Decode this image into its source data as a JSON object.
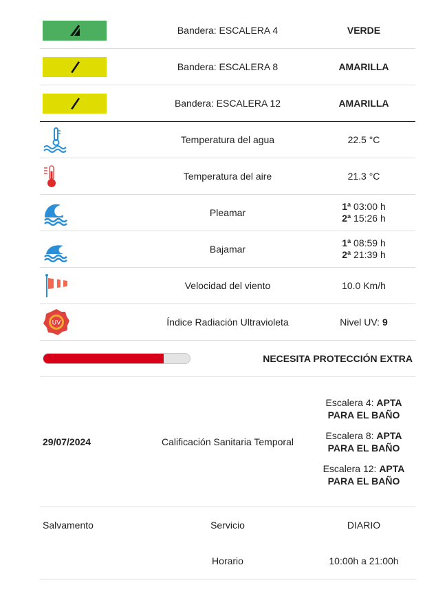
{
  "flags": [
    {
      "label": "Bandera: ESCALERA 4",
      "status": "VERDE",
      "color": "#4caf5f"
    },
    {
      "label": "Bandera: ESCALERA 8",
      "status": "AMARILLA",
      "color": "#dedc00"
    },
    {
      "label": "Bandera: ESCALERA 12",
      "status": "AMARILLA",
      "color": "#dedc00"
    }
  ],
  "water_temp": {
    "label": "Temperatura del agua",
    "value": "22.5 °C",
    "icon": "water-thermometer-icon"
  },
  "air_temp": {
    "label": "Temperatura del aire",
    "value": "21.3 °C",
    "icon": "thermometer-icon"
  },
  "high_tide": {
    "label": "Pleamar",
    "icon": "wave-icon",
    "first_ord": "1ª",
    "first_time": " 03:00 h",
    "second_ord": "2ª",
    "second_time": " 15:26 h"
  },
  "low_tide": {
    "label": "Bajamar",
    "icon": "low-wave-icon",
    "first_ord": "1ª",
    "first_time": " 08:59 h",
    "second_ord": "2ª",
    "second_time": " 21:39 h"
  },
  "wind": {
    "label": "Velocidad del viento",
    "value": "10.0 Km/h",
    "icon": "windsock-icon"
  },
  "uv": {
    "label": "Índice Radiación Ultravioleta",
    "prefix": "Nivel UV: ",
    "value": "9",
    "icon": "uv-icon"
  },
  "uv_bar": {
    "fill_fraction": 0.82,
    "message": "NECESITA PROTECCIÓN EXTRA",
    "color": "#d80018"
  },
  "sanitary": {
    "date": "29/07/2024",
    "label": "Calificación Sanitaria Temporal",
    "items": [
      {
        "prefix": "Escalera 4: ",
        "status": "APTA PARA EL BAÑO"
      },
      {
        "prefix": "Escalera 8: ",
        "status": "APTA PARA EL BAÑO"
      },
      {
        "prefix": "Escalera 12: ",
        "status": "APTA PARA EL BAÑO"
      }
    ]
  },
  "rescue": {
    "title": "Salvamento",
    "service_label": "Servicio",
    "service_value": "DIARIO",
    "schedule_label": "Horario",
    "schedule_value": "10:00h a 21:00h"
  }
}
